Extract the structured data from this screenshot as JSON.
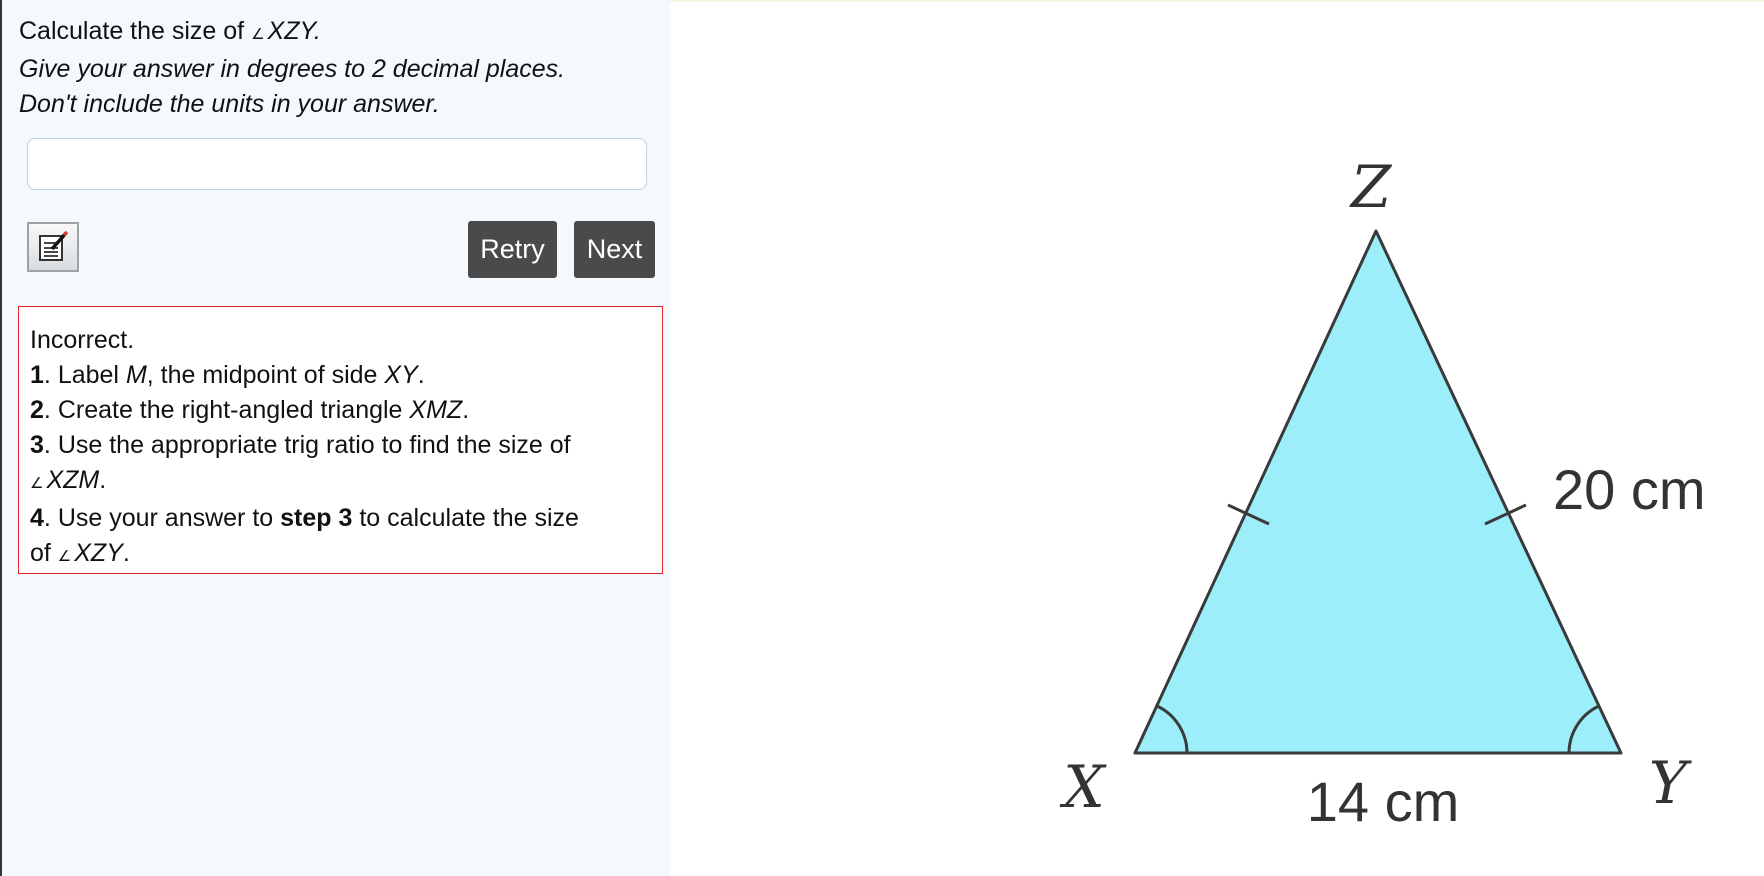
{
  "question": {
    "prefix": "Calculate the size of ",
    "angle_symbol": "∠",
    "angle_name": "XZY",
    "suffix": ".",
    "instruction_1": "Give your answer in degrees to 2 decimal places.",
    "instruction_2": "Don't include the units in your answer."
  },
  "answer": {
    "value": ""
  },
  "icons": {
    "notes": "notepad-pencil-icon"
  },
  "buttons": {
    "retry": "Retry",
    "next": "Next"
  },
  "feedback": {
    "status": "Incorrect.",
    "steps": [
      {
        "num": "1",
        "sep": ". ",
        "t1": "Label ",
        "i1": "M",
        "t2": ", the midpoint of side ",
        "i2": "XY",
        "t3": "."
      },
      {
        "num": "2",
        "sep": ". ",
        "t1": "Create the right-angled triangle ",
        "i1": "XMZ",
        "t2": "."
      },
      {
        "num": "3",
        "sep": ". ",
        "t1": "Use the appropriate trig ratio to find the size of",
        "angle": "∠",
        "i1": "XZM",
        "t2": "."
      },
      {
        "num": "4",
        "sep": ". ",
        "t1": "Use your answer to ",
        "b1": "step 3",
        "t2": " to calculate the size",
        "t3": "of ",
        "angle": "∠",
        "i1": "XZY",
        "t4": "."
      }
    ],
    "border_color": "#e3262b"
  },
  "diagram": {
    "vertex_x": "X",
    "vertex_y": "Y",
    "vertex_z": "Z",
    "side_label": "20 cm",
    "base_label": "14 cm",
    "fill_color": "#9ceefa",
    "stroke_color": "#3a3a3a"
  },
  "colors": {
    "panel_background": "#f3f9fd",
    "button_background": "#4a4a4a"
  }
}
